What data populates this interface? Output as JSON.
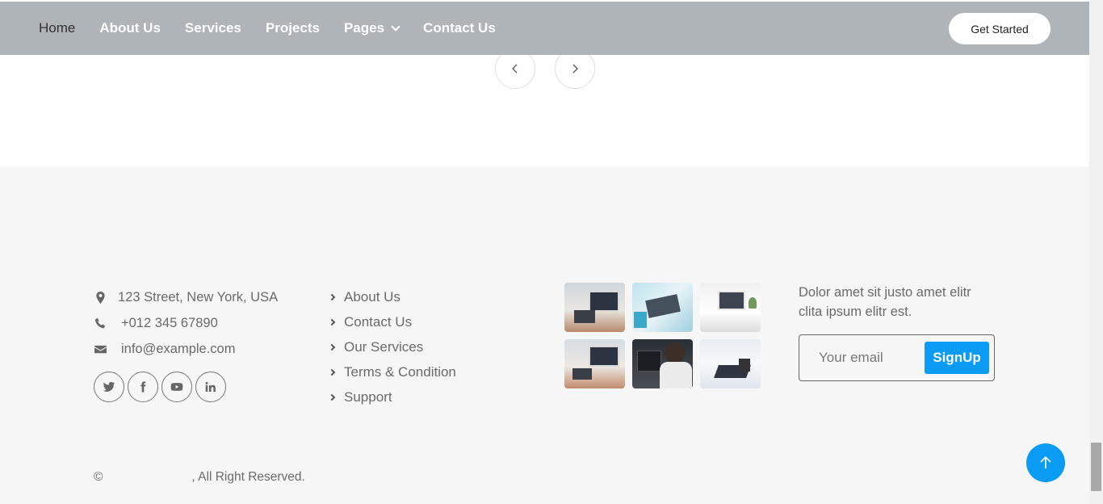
{
  "nav": {
    "items": [
      {
        "label": "Home"
      },
      {
        "label": "About Us"
      },
      {
        "label": "Services"
      },
      {
        "label": "Projects"
      },
      {
        "label": "Pages"
      },
      {
        "label": "Contact Us"
      }
    ],
    "cta_label": "Get Started"
  },
  "carousel": {
    "prev_icon": "chevron-left-icon",
    "next_icon": "chevron-right-icon"
  },
  "footer": {
    "contact": {
      "address": "123 Street, New York, USA",
      "phone": "+012 345 67890",
      "email": "info@example.com"
    },
    "socials": [
      "twitter-icon",
      "facebook-icon",
      "youtube-icon",
      "linkedin-icon"
    ],
    "links": [
      "About Us",
      "Contact Us",
      "Our Services",
      "Terms & Condition",
      "Support"
    ],
    "gallery_count": 6,
    "newsletter": {
      "text": "Dolor amet sit justo amet elitr clita ipsum elitr est.",
      "placeholder": "Your email",
      "button": "SignUp"
    },
    "copyright_symbol": "©",
    "copyright_suffix": ", All Right Reserved."
  },
  "colors": {
    "accent": "#0a9bf5",
    "navbar": "#aeb4b7",
    "footer_bg": "#f6f6f6"
  }
}
